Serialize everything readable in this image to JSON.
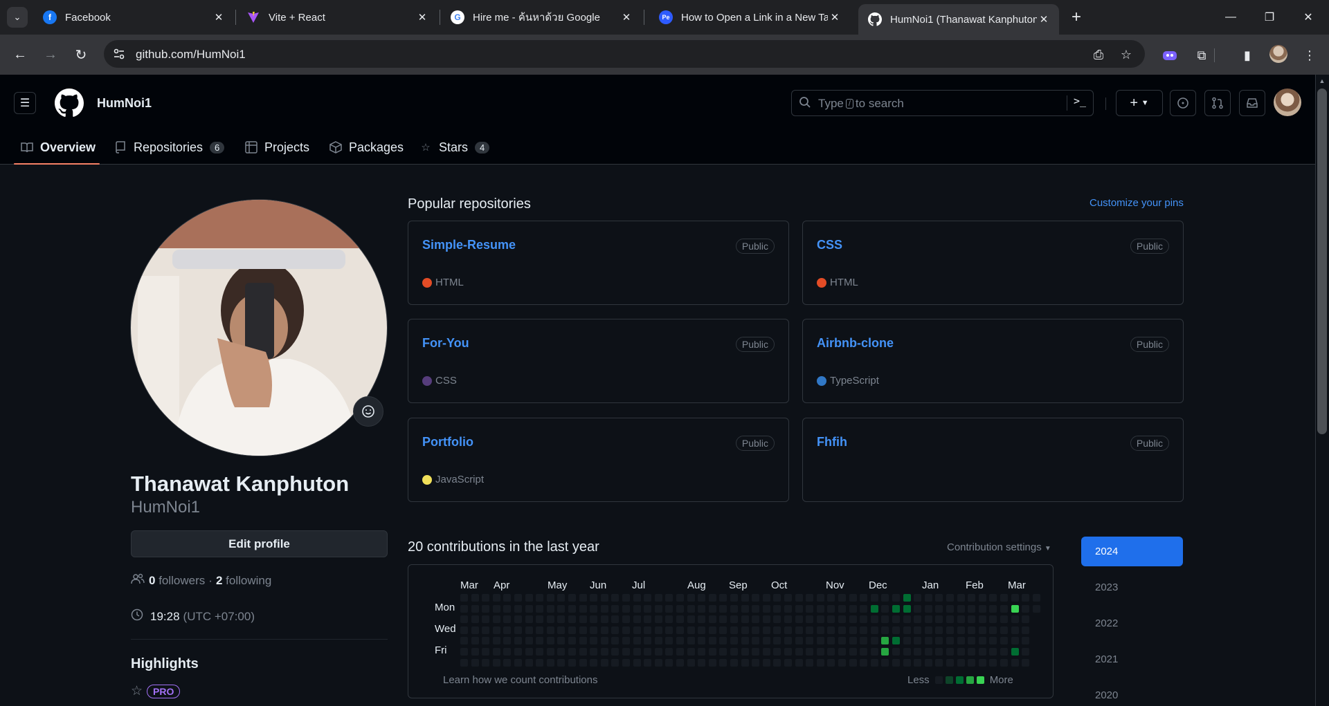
{
  "browser": {
    "tabs": [
      {
        "title": "Facebook",
        "icon": "facebook-icon",
        "color": "#1877f2"
      },
      {
        "title": "Vite + React",
        "icon": "vite-icon",
        "color": "#a855f7"
      },
      {
        "title": "Hire me - ค้นหาด้วย Google",
        "icon": "google-icon",
        "color": "#ffffff"
      },
      {
        "title": "How to Open a Link in a New Ta",
        "icon": "pe-icon",
        "color": "#2e5bff"
      },
      {
        "title": "HumNoi1 (Thanawat Kanphuton",
        "icon": "github-icon",
        "color": "#ffffff"
      }
    ],
    "url": "github.com/HumNoi1"
  },
  "header": {
    "username": "HumNoi1",
    "search_prefix": "Type",
    "search_key": "/",
    "search_suffix": "to search",
    "search_command": ">_",
    "new_label": "+"
  },
  "tabs": {
    "overview": "Overview",
    "repositories": "Repositories",
    "repositories_count": "6",
    "projects": "Projects",
    "packages": "Packages",
    "stars": "Stars",
    "stars_count": "4"
  },
  "profile": {
    "name": "Thanawat Kanphuton",
    "login": "HumNoi1",
    "edit_label": "Edit profile",
    "followers_count": "0",
    "followers_label": "followers",
    "separator": "·",
    "following_count": "2",
    "following_label": "following",
    "local_time": "19:28",
    "utc_offset": "(UTC +07:00)",
    "highlights_title": "Highlights",
    "pro_label": "PRO"
  },
  "popular": {
    "title": "Popular repositories",
    "customize_label": "Customize your pins",
    "repos": [
      {
        "name": "Simple-Resume",
        "visibility": "Public",
        "language": "HTML",
        "color": "#e34c26"
      },
      {
        "name": "CSS",
        "visibility": "Public",
        "language": "HTML",
        "color": "#e34c26"
      },
      {
        "name": "For-You",
        "visibility": "Public",
        "language": "CSS",
        "color": "#563d7c"
      },
      {
        "name": "Airbnb-clone",
        "visibility": "Public",
        "language": "TypeScript",
        "color": "#3178c6"
      },
      {
        "name": "Portfolio",
        "visibility": "Public",
        "language": "JavaScript",
        "color": "#f1e05a"
      },
      {
        "name": "Fhfih",
        "visibility": "Public",
        "language": "",
        "color": ""
      }
    ]
  },
  "contributions": {
    "title": "20 contributions in the last year",
    "settings_label": "Contribution settings",
    "months": [
      "Mar",
      "Apr",
      "May",
      "Jun",
      "Jul",
      "Aug",
      "Sep",
      "Oct",
      "Nov",
      "Dec",
      "Jan",
      "Feb",
      "Mar"
    ],
    "days": [
      "Mon",
      "Wed",
      "Fri"
    ],
    "learn_label": "Learn how we count contributions",
    "legend_less": "Less",
    "legend_more": "More",
    "level_colors": [
      "#161b22",
      "#0e4429",
      "#006d32",
      "#26a641",
      "#39d353"
    ],
    "weeks": 54,
    "active_cells": [
      {
        "week": 38,
        "day": 1,
        "level": 2
      },
      {
        "week": 39,
        "day": 4,
        "level": 3
      },
      {
        "week": 39,
        "day": 5,
        "level": 3
      },
      {
        "week": 40,
        "day": 1,
        "level": 2
      },
      {
        "week": 40,
        "day": 4,
        "level": 2
      },
      {
        "week": 41,
        "day": 0,
        "level": 2
      },
      {
        "week": 41,
        "day": 1,
        "level": 2
      },
      {
        "week": 51,
        "day": 1,
        "level": 4
      },
      {
        "week": 51,
        "day": 5,
        "level": 2
      }
    ],
    "years": [
      "2024",
      "2023",
      "2022",
      "2021",
      "2020"
    ],
    "selected_year": "2024"
  }
}
